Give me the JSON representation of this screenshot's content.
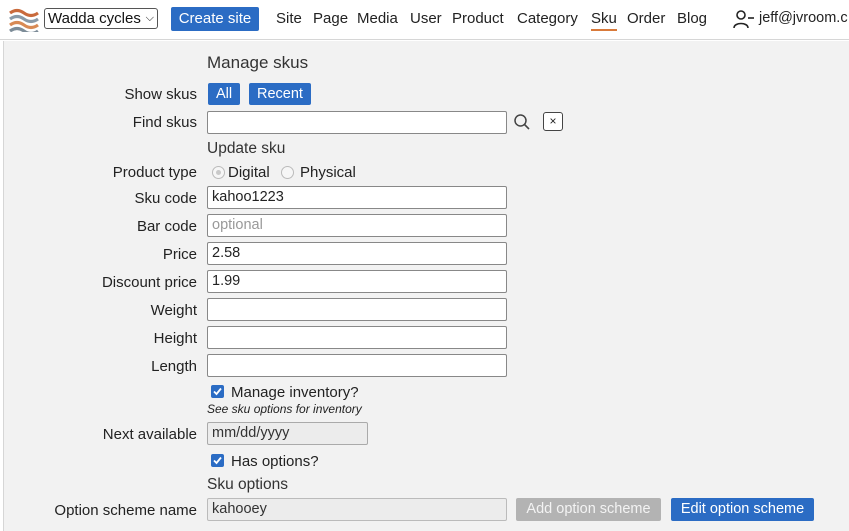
{
  "header": {
    "logo_icon": "stacked-waves-logo",
    "site_select": {
      "value": "Wadda cycles"
    },
    "create_site_label": "Create site",
    "nav": [
      {
        "label": "Site"
      },
      {
        "label": "Page"
      },
      {
        "label": "Media"
      },
      {
        "label": "User"
      },
      {
        "label": "Product"
      },
      {
        "label": "Category"
      },
      {
        "label": "Sku",
        "active": true
      },
      {
        "label": "Order"
      },
      {
        "label": "Blog"
      }
    ],
    "user_icon": "user-logout-icon",
    "user_email": "jeff@jvroom.c"
  },
  "form": {
    "title": "Manage skus",
    "show_skus": {
      "label": "Show skus",
      "all_label": "All",
      "recent_label": "Recent"
    },
    "find_skus": {
      "label": "Find skus",
      "value": "",
      "search_icon": "search-icon",
      "clear_label": "×"
    },
    "update_heading": "Update sku",
    "product_type": {
      "label": "Product type",
      "options": [
        "Digital",
        "Physical"
      ],
      "selected": "Digital"
    },
    "sku_code": {
      "label": "Sku code",
      "value": "kahoo1223"
    },
    "bar_code": {
      "label": "Bar code",
      "value": "",
      "placeholder": "optional"
    },
    "price": {
      "label": "Price",
      "value": "2.58"
    },
    "discount_price": {
      "label": "Discount price",
      "value": "1.99"
    },
    "weight": {
      "label": "Weight",
      "value": ""
    },
    "height": {
      "label": "Height",
      "value": ""
    },
    "length": {
      "label": "Length",
      "value": ""
    },
    "manage_inventory": {
      "label": "Manage inventory?",
      "checked": true,
      "hint": "See sku options for inventory"
    },
    "next_available": {
      "label": "Next available",
      "placeholder": "mm/dd/yyyy"
    },
    "has_options": {
      "label": "Has options?",
      "checked": true
    },
    "sku_options_heading": "Sku options",
    "option_scheme": {
      "label": "Option scheme name",
      "value": "kahooey",
      "add_label": "Add option scheme",
      "edit_label": "Edit option scheme"
    }
  },
  "colors": {
    "accent": "#2b6cc4",
    "active_underline": "#d97a3a",
    "panel_bg": "#f2f2f2"
  }
}
